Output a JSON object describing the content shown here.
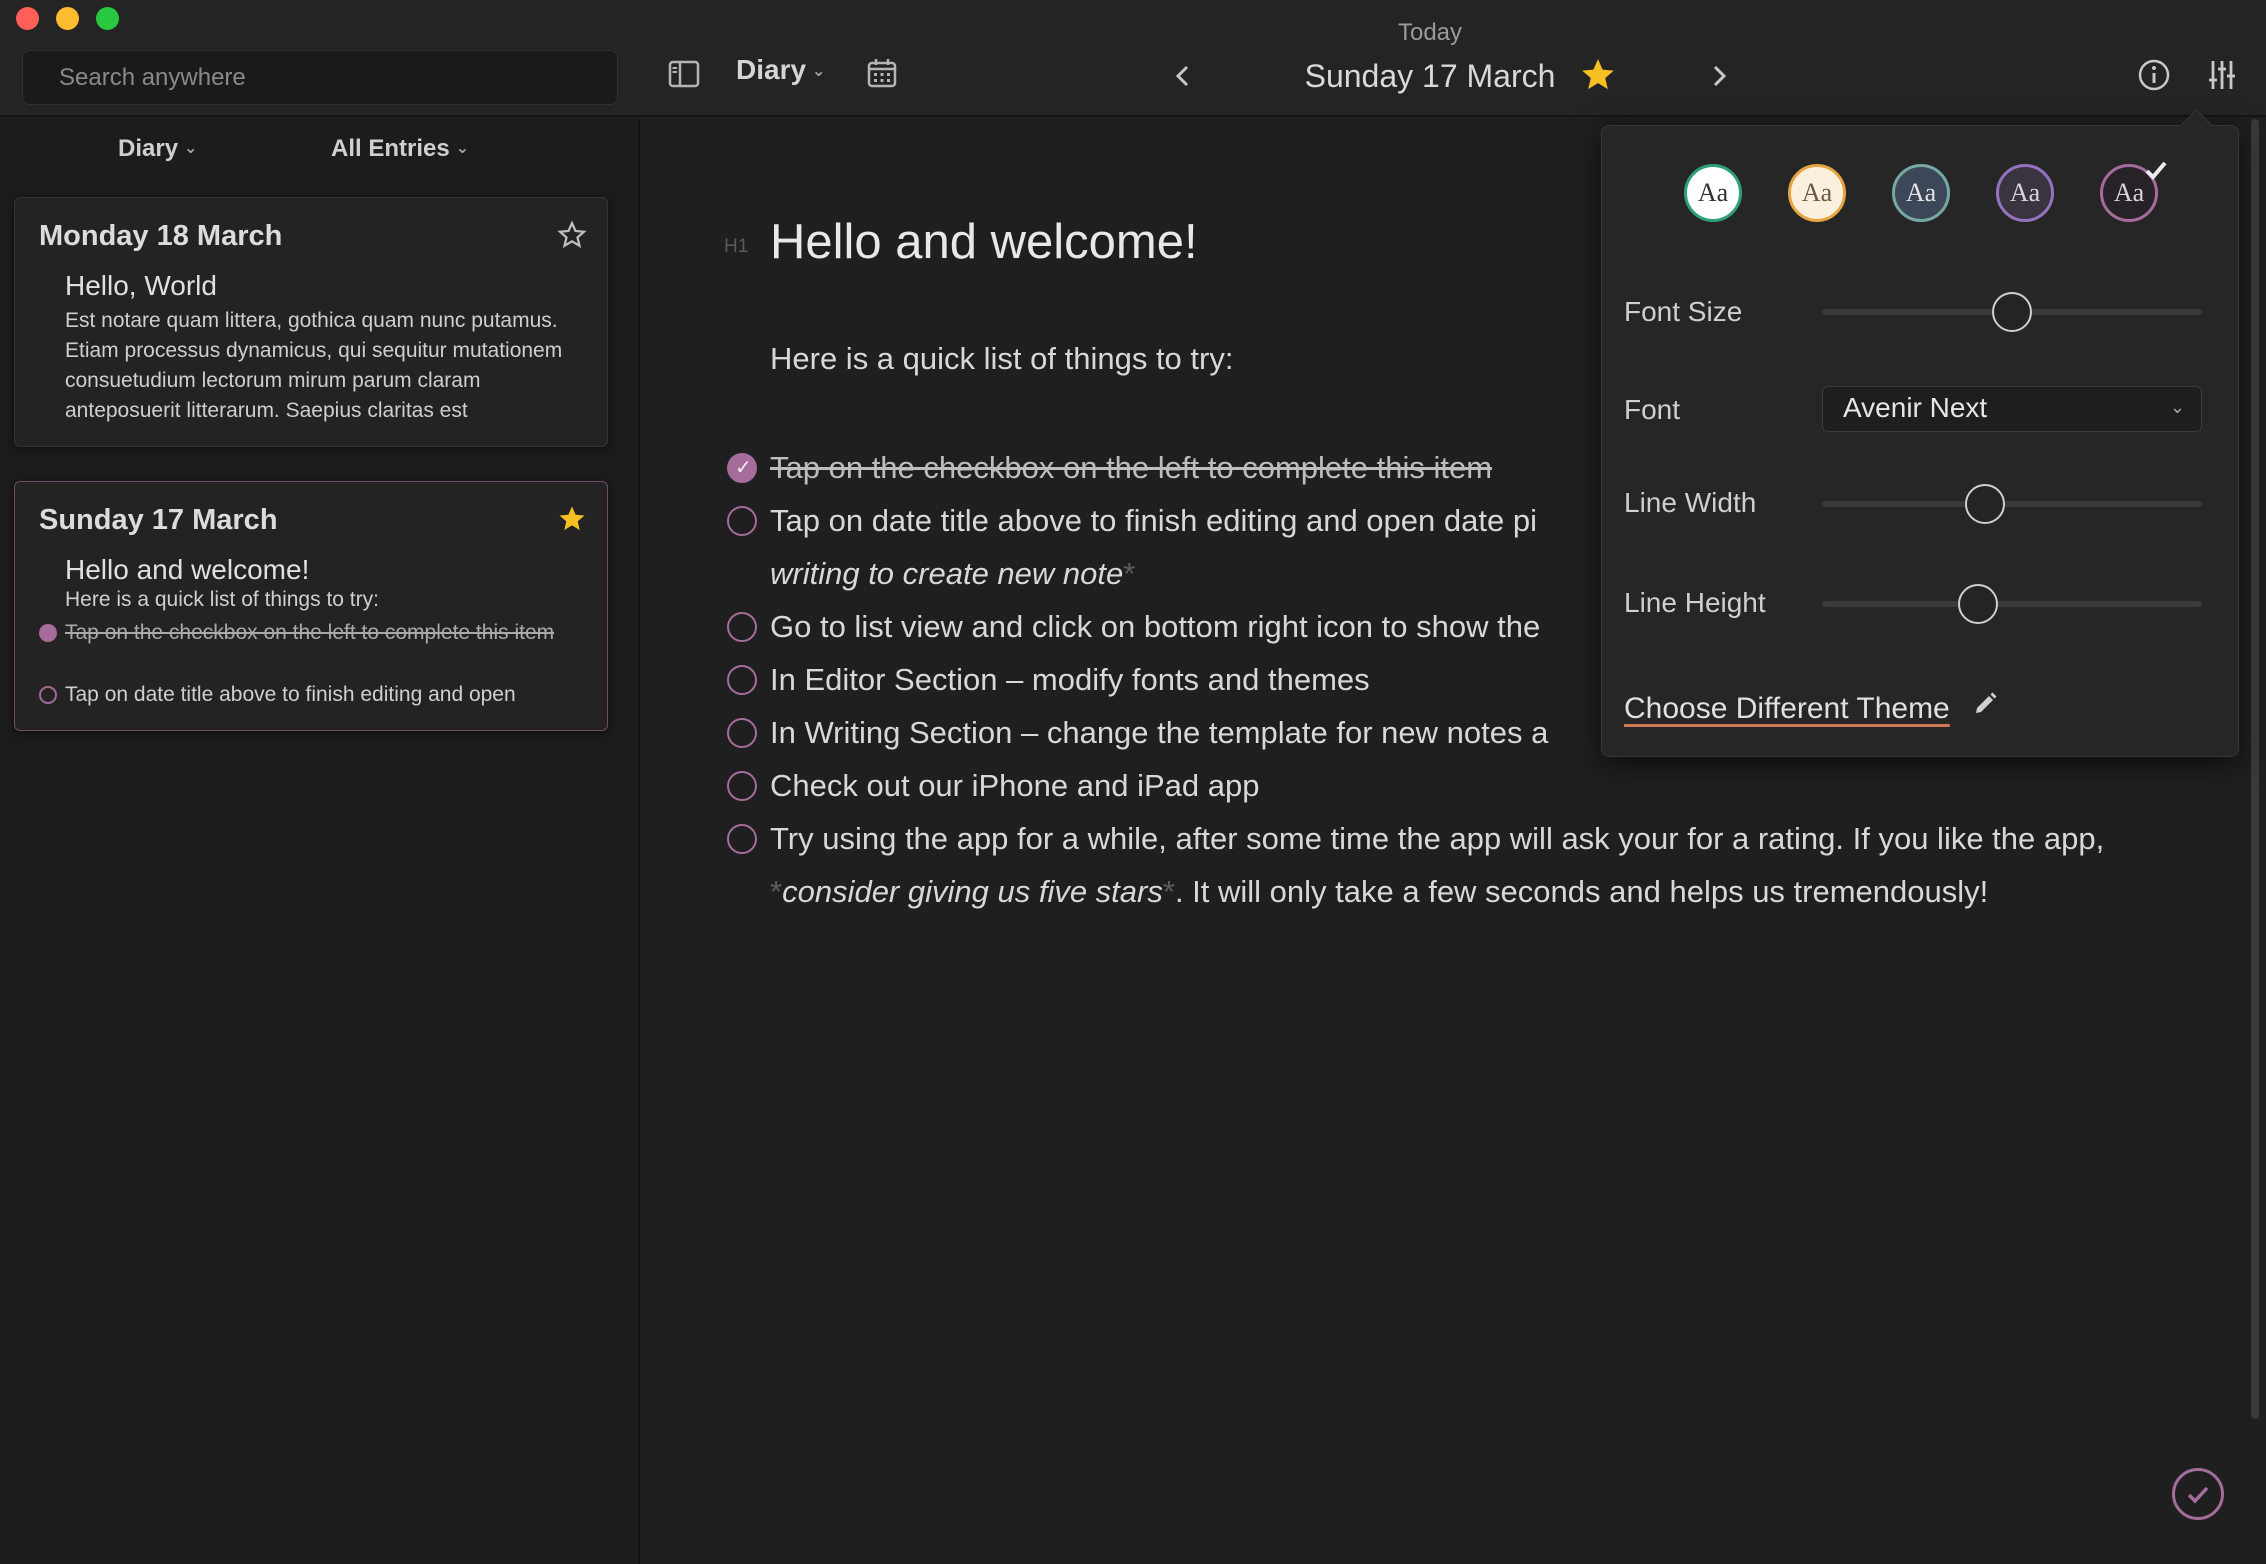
{
  "toolbar": {
    "search_placeholder": "Search anywhere",
    "diary_label": "Diary",
    "today_label": "Today",
    "date_title": "Sunday 17 March"
  },
  "sidebar": {
    "filter_diary": "Diary",
    "filter_all": "All Entries",
    "cards": [
      {
        "date": "Monday 18 March",
        "title": "Hello, World",
        "body": "Est notare quam littera, gothica quam nunc putamus. Etiam processus dynamicus, qui sequitur mutationem consuetudium lectorum mirum parum claram anteposuerit litterarum. Saepius claritas est",
        "starred": false
      },
      {
        "date": "Sunday 17 March",
        "title": "Hello and welcome!",
        "subtitle": "Here is a quick list of things to try:",
        "todos": [
          {
            "text": "Tap on the checkbox on the left to complete this item",
            "done": true
          },
          {
            "text": "Tap on date title above to finish editing and open",
            "done": false
          }
        ],
        "starred": true
      }
    ]
  },
  "editor": {
    "heading_marker": "H1",
    "heading": "Hello and welcome!",
    "intro": "Here is a quick list of things to try:",
    "todos": [
      {
        "text": "Tap on the checkbox on the left to complete this item",
        "done": true
      },
      {
        "text_a": "Tap on date title above to finish editing and open date pi",
        "text_b": "writing to create new note",
        "mark": "*",
        "done": false
      },
      {
        "text": "Go to list view and click on bottom right icon to show the",
        "done": false
      },
      {
        "text": "In Editor Section – modify fonts and themes",
        "done": false
      },
      {
        "text": "In Writing Section – change the template for new notes a",
        "done": false
      },
      {
        "text": "Check out our iPhone and iPad app",
        "done": false
      },
      {
        "text_a": "Try using the app for a while, after some time the app will ask your for a rating. If you like the app, ",
        "mark_open": "*",
        "italic": "consider giving us five stars",
        "mark_close": "*",
        "text_b": ". It will only take a few seconds and helps us tremendously!",
        "done": false
      }
    ]
  },
  "popover": {
    "theme_swatch_label": "Aa",
    "font_size_label": "Font Size",
    "font_size_value": 0.5,
    "font_label": "Font",
    "font_value": "Avenir Next",
    "line_width_label": "Line Width",
    "line_width_value": 0.43,
    "line_height_label": "Line Height",
    "line_height_value": 0.41,
    "choose_theme_label": "Choose Different Theme",
    "selected_theme_index": 4
  },
  "colors": {
    "accent": "#a56c9c",
    "star": "#f5c023",
    "background": "#1f1f1f"
  },
  "icons": [
    "sidebar-toggle-icon",
    "chevron-down-icon",
    "calendar-icon",
    "chevron-left-icon",
    "chevron-right-icon",
    "star-icon",
    "info-icon",
    "settings-sliders-icon",
    "checkmark-icon",
    "pencil-icon"
  ]
}
